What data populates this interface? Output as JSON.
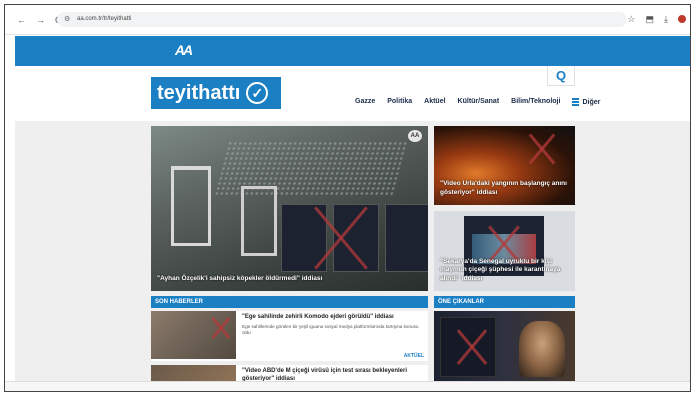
{
  "browser": {
    "url": "aa.com.tr/tr/teyithatti",
    "nav_back": "←",
    "nav_forward": "→",
    "nav_reload": "C",
    "site_settings_icon": "tune-icon",
    "actions": [
      "☆",
      "⬒",
      "⤓"
    ]
  },
  "aa_bar": {
    "logo": "AA"
  },
  "header": {
    "brand": "teyithattı",
    "brand_check": "✓",
    "search_icon": "Q",
    "menu": [
      "Gazze",
      "Politika",
      "Aktüel",
      "Kültür/Sanat",
      "Bilim/Teknoloji"
    ],
    "more_label": "Diğer"
  },
  "hero": {
    "caption": "\"Ayhan Özçelik'i sahipsiz köpekler öldürmedi\" iddiası"
  },
  "side_cards": [
    {
      "caption": "\"Video Urla'daki yangının başlangıç anını gösteriyor\" iddiası"
    },
    {
      "caption": "\"Sekarya'da Senegal uyruklu bir kişi maymun çiçeği şüphesi ile karantinaya alındı\" iddiası"
    }
  ],
  "sections": {
    "latest": "SON HABERLER",
    "featured": "ÖNE ÇIKANLAR"
  },
  "news": [
    {
      "title": "\"Ege sahilinde zehirli Komodo ejderi görüldü\" iddiası",
      "desc": "Ege sahillerinde görülen bir yeşil iguana sosyal medya platformlarında tartışma konusu oldu",
      "category": "AKTÜEL"
    },
    {
      "title": "\"Video ABD'de M çiçeği virüsü için test sırası bekleyenleri gösteriyor\" iddiası",
      "desc": "",
      "category": ""
    }
  ],
  "colors": {
    "brand_blue": "#1b7fc4",
    "x_red": "#b33a3a"
  }
}
